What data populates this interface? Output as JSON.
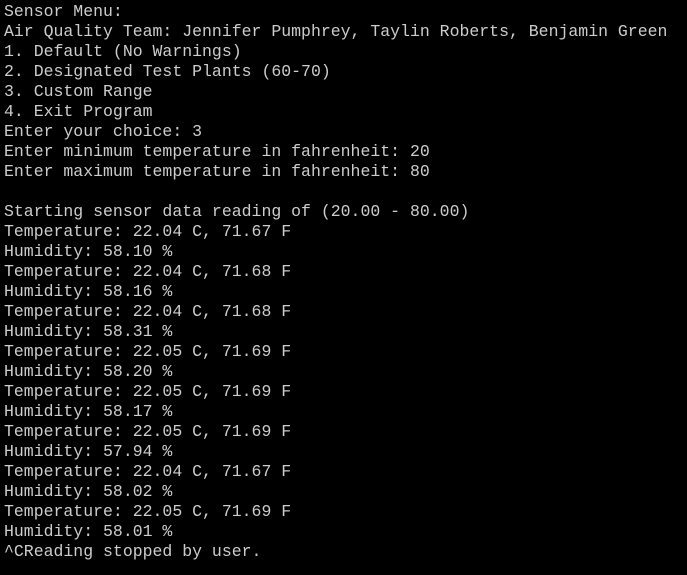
{
  "terminal": {
    "colors": {
      "background": "#000000",
      "foreground": "#cccccc"
    },
    "lines": [
      "Sensor Menu:",
      "Air Quality Team: Jennifer Pumphrey, Taylin Roberts, Benjamin Green",
      "1. Default (No Warnings)",
      "2. Designated Test Plants (60-70)",
      "3. Custom Range",
      "4. Exit Program",
      "Enter your choice: 3",
      "Enter minimum temperature in fahrenheit: 20",
      "Enter maximum temperature in fahrenheit: 80",
      "",
      "Starting sensor data reading of (20.00 - 80.00)",
      "Temperature: 22.04 C, 71.67 F",
      "Humidity: 58.10 %",
      "Temperature: 22.04 C, 71.68 F",
      "Humidity: 58.16 %",
      "Temperature: 22.04 C, 71.68 F",
      "Humidity: 58.31 %",
      "Temperature: 22.05 C, 71.69 F",
      "Humidity: 58.20 %",
      "Temperature: 22.05 C, 71.69 F",
      "Humidity: 58.17 %",
      "Temperature: 22.05 C, 71.69 F",
      "Humidity: 57.94 %",
      "Temperature: 22.04 C, 71.67 F",
      "Humidity: 58.02 %",
      "Temperature: 22.05 C, 71.69 F",
      "Humidity: 58.01 %",
      "^CReading stopped by user."
    ]
  }
}
